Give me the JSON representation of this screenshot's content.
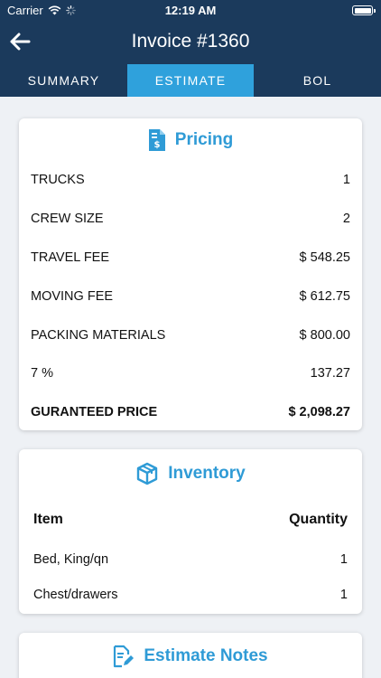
{
  "status_bar": {
    "carrier": "Carrier",
    "time": "12:19 AM"
  },
  "nav": {
    "back_icon": "arrow-left-icon",
    "title": "Invoice #1360"
  },
  "tabs": [
    {
      "label": "SUMMARY",
      "active": false
    },
    {
      "label": "ESTIMATE",
      "active": true
    },
    {
      "label": "BOL",
      "active": false
    }
  ],
  "colors": {
    "header_bg": "#1b3a5c",
    "accent": "#2fa1dc",
    "background": "#eef1f5"
  },
  "pricing": {
    "title": "Pricing",
    "icon": "invoice-dollar-icon",
    "rows": [
      {
        "label": "TRUCKS",
        "value": "1"
      },
      {
        "label": "CREW SIZE",
        "value": "2"
      },
      {
        "label": "TRAVEL FEE",
        "value": "$ 548.25"
      },
      {
        "label": "MOVING FEE",
        "value": "$ 612.75"
      },
      {
        "label": "PACKING MATERIALS",
        "value": "$ 800.00"
      },
      {
        "label": "7 %",
        "value": "137.27"
      }
    ],
    "total": {
      "label": "GURANTEED PRICE",
      "value": "$ 2,098.27"
    }
  },
  "inventory": {
    "title": "Inventory",
    "icon": "box-icon",
    "col_item": "Item",
    "col_quantity": "Quantity",
    "items": [
      {
        "name": "Bed, King/qn",
        "quantity": "1"
      },
      {
        "name": "Chest/drawers",
        "quantity": "1"
      }
    ]
  },
  "notes": {
    "title": "Estimate Notes",
    "icon": "edit-note-icon"
  }
}
